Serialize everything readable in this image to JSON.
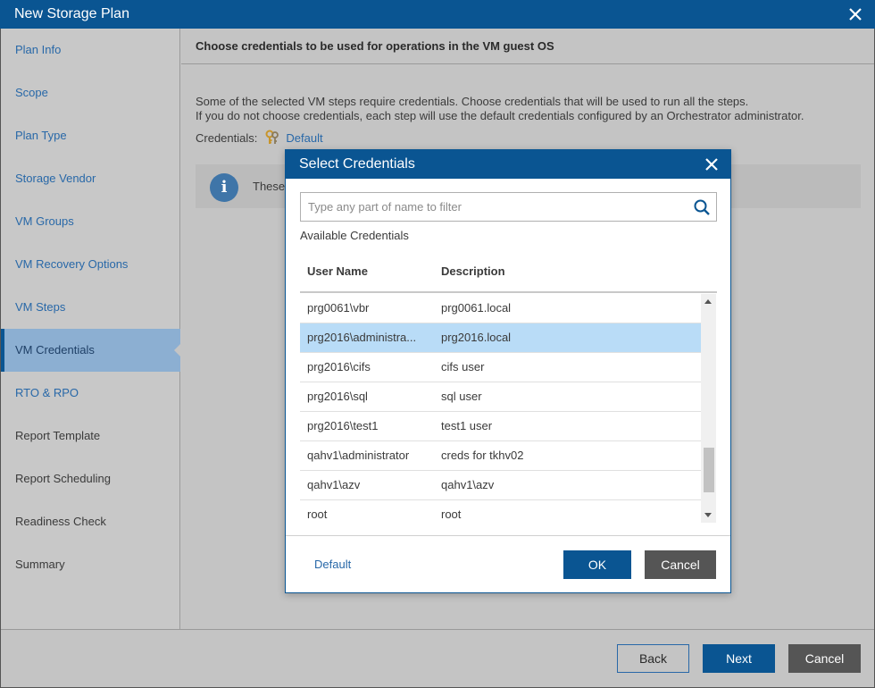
{
  "window": {
    "title": "New Storage Plan"
  },
  "sidebar": {
    "items": [
      {
        "label": "Plan Info"
      },
      {
        "label": "Scope"
      },
      {
        "label": "Plan Type"
      },
      {
        "label": "Storage Vendor"
      },
      {
        "label": "VM Groups"
      },
      {
        "label": "VM Recovery Options"
      },
      {
        "label": "VM Steps"
      },
      {
        "label": "VM Credentials"
      },
      {
        "label": "RTO & RPO"
      },
      {
        "label": "Report Template"
      },
      {
        "label": "Report Scheduling"
      },
      {
        "label": "Readiness Check"
      },
      {
        "label": "Summary"
      }
    ],
    "active_index": 7
  },
  "main": {
    "heading": "Choose credentials to be used for operations in the VM guest OS",
    "description_line1": "Some of the selected VM steps require credentials. Choose credentials that will be used to run all the steps.",
    "description_line2": "If you do not choose credentials, each step will use the default credentials configured by an Orchestrator administrator.",
    "credentials_label": "Credentials:",
    "credentials_value": "Default",
    "info_text": "These"
  },
  "footer": {
    "back_label": "Back",
    "next_label": "Next",
    "cancel_label": "Cancel"
  },
  "modal": {
    "title": "Select Credentials",
    "search_placeholder": "Type any part of name to filter",
    "available_label": "Available Credentials",
    "columns": {
      "user_name": "User Name",
      "description": "Description"
    },
    "rows": [
      {
        "user": "prg0061\\vbr",
        "desc": "prg0061.local"
      },
      {
        "user": "prg2016\\administra...",
        "desc": "prg2016.local"
      },
      {
        "user": "prg2016\\cifs",
        "desc": "cifs user"
      },
      {
        "user": "prg2016\\sql",
        "desc": "sql user"
      },
      {
        "user": "prg2016\\test1",
        "desc": "test1 user"
      },
      {
        "user": "qahv1\\administrator",
        "desc": "creds for tkhv02"
      },
      {
        "user": "qahv1\\azv",
        "desc": "qahv1\\azv"
      },
      {
        "user": "root",
        "desc": "root"
      }
    ],
    "selected_row": 1,
    "default_link": "Default",
    "ok_label": "OK",
    "cancel_label": "Cancel"
  },
  "colors": {
    "brand": "#0a5592",
    "link": "#2868a8",
    "selected_row": "#b9dcf7",
    "active_nav": "#8cafd2"
  }
}
